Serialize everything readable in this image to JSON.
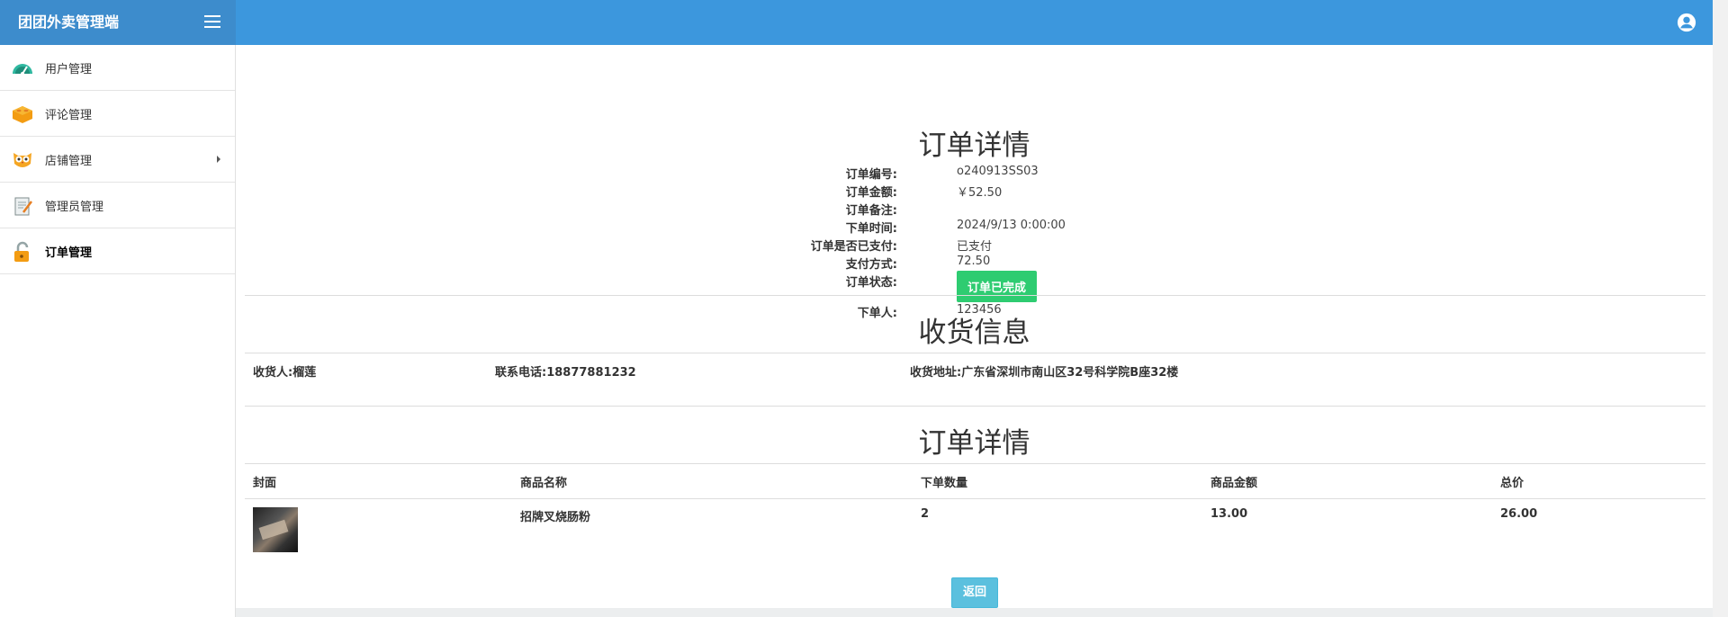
{
  "app": {
    "title": "团团外卖管理端"
  },
  "sidebar": {
    "items": [
      {
        "label": "用户管理",
        "icon": "dashboard-gauge-icon"
      },
      {
        "label": "评论管理",
        "icon": "lego-block-icon"
      },
      {
        "label": "店铺管理",
        "icon": "owl-icon",
        "has_submenu": true
      },
      {
        "label": "管理员管理",
        "icon": "notepad-icon"
      },
      {
        "label": "订单管理",
        "icon": "unlocked-padlock-icon",
        "active": true
      }
    ]
  },
  "order": {
    "title": "订单详情",
    "fields": {
      "order_no_label": "订单编号:",
      "order_no": "o240913SS03",
      "amount_label": "订单金额:",
      "amount": "￥52.50",
      "remark_label": "订单备注:",
      "remark": "",
      "time_label": "下单时间:",
      "time": "2024/9/13 0:00:00",
      "paid_label": "订单是否已支付:",
      "paid": "已支付",
      "pay_method_label": "支付方式:",
      "pay_method": "72.50",
      "status_label": "订单状态:",
      "status": "订单已完成",
      "user_label": "下单人:",
      "user": "123456"
    }
  },
  "receiver": {
    "title": "收货信息",
    "name_label": "收货人:",
    "name": "榴莲",
    "phone_label": "联系电话:",
    "phone": "18877881232",
    "address_label": "收货地址:",
    "address": "广东省深圳市南山区32号科学院B座32楼"
  },
  "items": {
    "title": "订单详情",
    "columns": [
      "封面",
      "商品名称",
      "下单数量",
      "商品金额",
      "总价"
    ],
    "rows": [
      {
        "name": "招牌叉烧肠粉",
        "qty": "2",
        "price": "13.00",
        "total": "26.00"
      }
    ]
  },
  "actions": {
    "back_label": "返回"
  },
  "colors": {
    "header": "#3c97dd",
    "brand_bar": "#3d8ccc",
    "status_green": "#2ecc71",
    "back_button": "#5bc0de"
  }
}
